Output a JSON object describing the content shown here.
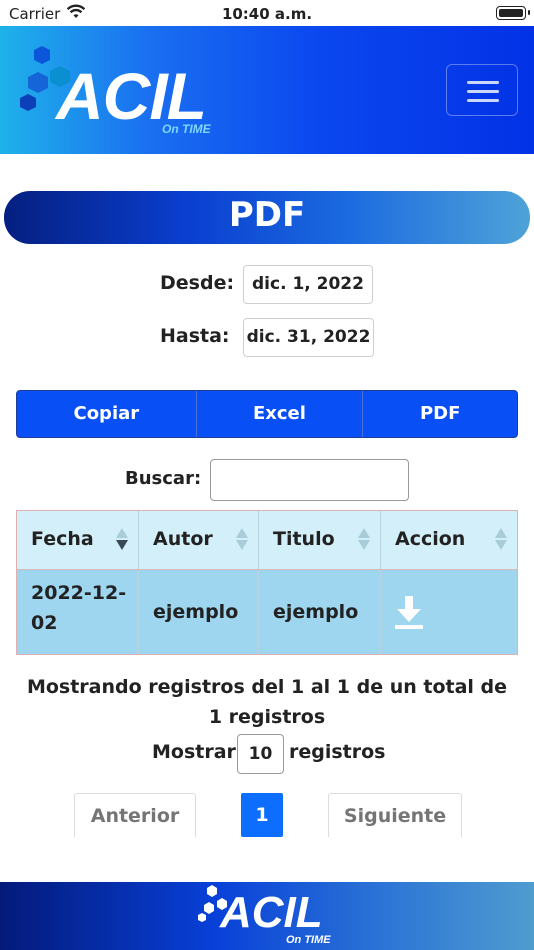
{
  "status_bar": {
    "carrier": "Carrier",
    "time": "10:40 a.m."
  },
  "header": {
    "logo_text": "ACIL",
    "logo_tagline": "On TIME"
  },
  "page": {
    "title": "PDF"
  },
  "filters": {
    "from_label": "Desde:",
    "from_value": "dic. 1, 2022",
    "to_label": "Hasta:",
    "to_value": "dic. 31, 2022"
  },
  "export_buttons": [
    "Copiar",
    "Excel",
    "PDF"
  ],
  "search": {
    "label": "Buscar:",
    "value": ""
  },
  "table": {
    "columns": [
      "Fecha",
      "Autor",
      "Titulo",
      "Accion"
    ],
    "sorted_column": "Fecha",
    "sort_direction": "desc",
    "rows": [
      {
        "fecha": "2022-12-02",
        "autor": "ejemplo",
        "titulo": "ejemplo",
        "accion_icon": "download-icon"
      }
    ]
  },
  "info": {
    "text": "Mostrando registros del 1 al 1 de un total de 1 registros"
  },
  "length_menu": {
    "before": "Mostrar",
    "value": "10",
    "after": "registros"
  },
  "pagination": {
    "prev": "Anterior",
    "current": "1",
    "next": "Siguiente"
  },
  "footer": {
    "logo_text": "ACIL",
    "logo_tagline": "On TIME"
  },
  "colors": {
    "primary": "#0850f5",
    "header_accent": "#1fb2ea",
    "table_row": "#9ed5ef",
    "table_header": "#d3eff9",
    "page_active": "#0d6efd"
  }
}
